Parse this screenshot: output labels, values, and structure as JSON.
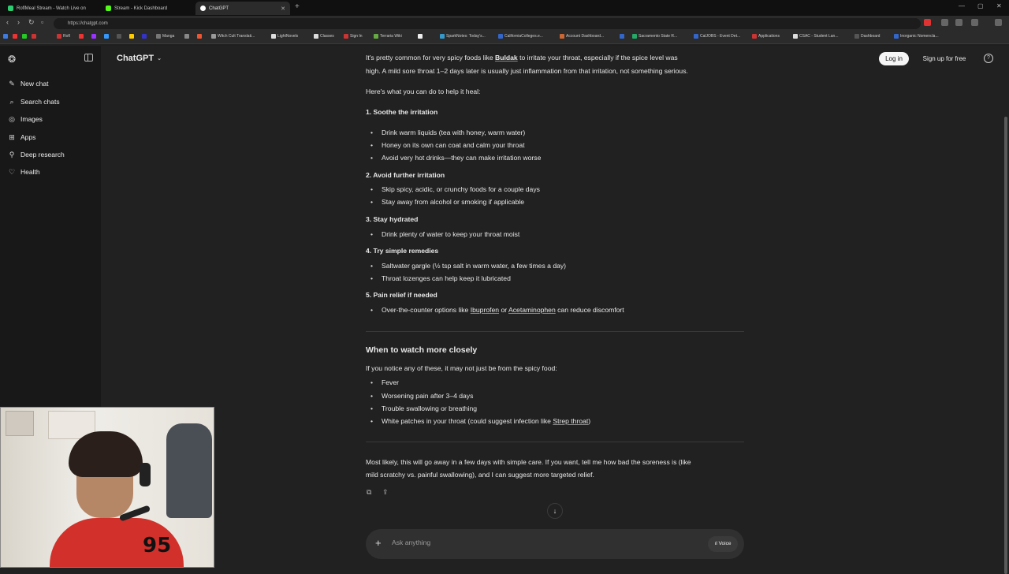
{
  "browser": {
    "tabs": [
      {
        "title": "RoflMeal Stream - Watch Live on",
        "icon_color": "#2ecc71"
      },
      {
        "title": "Stream - Kick Dashboard",
        "icon_color": "#53fc18"
      },
      {
        "title": "ChatGPT",
        "icon_color": "#ffffff"
      }
    ],
    "url": "https://chatgpt.com",
    "bookmarks": [
      "Rofl",
      "Manga",
      "Witch Cult Translati...",
      "LightNovels",
      "Classes",
      "Sign In",
      "Terraria Wiki",
      "SparkNotes: Today's...",
      "CaliforniaColleges.e...",
      "Account Dashboard...",
      "Sacramento State R...",
      "CalJOBS - Event Det...",
      "Applications",
      "CSAC - Student Lan...",
      "Dashboard",
      "Inorganic Nomencla..."
    ]
  },
  "sidebar": {
    "items": [
      {
        "label": "New chat",
        "icon": "compose-icon"
      },
      {
        "label": "Search chats",
        "icon": "search-icon"
      },
      {
        "label": "Images",
        "icon": "images-icon"
      },
      {
        "label": "Apps",
        "icon": "apps-icon"
      },
      {
        "label": "Deep research",
        "icon": "telescope-icon"
      },
      {
        "label": "Health",
        "icon": "heart-icon"
      }
    ]
  },
  "header": {
    "model": "ChatGPT",
    "login": "Log in",
    "signup": "Sign up for free",
    "help": "?"
  },
  "message": {
    "intro_a": "It's pretty common for very spicy foods like ",
    "intro_link": "Buldak",
    "intro_b": " to irritate your throat, especially if the spice level was",
    "intro_c": "high. A mild sore throat 1–2 days later is usually just inflammation from that irritation, not something serious.",
    "heal": "Here's what you can do to help it heal:",
    "s1": "1. Soothe the irritation",
    "s1_items": [
      "Drink warm liquids (tea with honey, warm water)",
      "Honey on its own can coat and calm your throat",
      "Avoid very hot drinks—they can make irritation worse"
    ],
    "s2": "2. Avoid further irritation",
    "s2_items": [
      "Skip spicy, acidic, or crunchy foods for a couple days",
      "Stay away from alcohol or smoking if applicable"
    ],
    "s3": "3. Stay hydrated",
    "s3_items": [
      "Drink plenty of water to keep your throat moist"
    ],
    "s4": "4. Try simple remedies",
    "s4_items": [
      "Saltwater gargle (½ tsp salt in warm water, a few times a day)",
      "Throat lozenges can help keep it lubricated"
    ],
    "s5": "5. Pain relief if needed",
    "s5_a": "Over-the-counter options like ",
    "s5_l1": "Ibuprofen",
    "s5_or": " or ",
    "s5_l2": "Acetaminophen",
    "s5_b": " can reduce discomfort",
    "watch_title": "When to watch more closely",
    "watch_intro": "If you notice any of these, it may not just be from the spicy food:",
    "watch_items": [
      "Fever",
      "Worsening pain after 3–4 days",
      "Trouble swallowing or breathing"
    ],
    "watch_last_a": "White patches in your throat (could suggest infection like ",
    "watch_last_link": "Strep throat",
    "watch_last_b": ")",
    "closing_a": "Most likely, this will go away in a few days with simple care. If you want, tell me how bad the soreness is (like",
    "closing_b": "mild scratchy vs. painful swallowing), and I can suggest more targeted relief."
  },
  "composer": {
    "placeholder": "Ask anything",
    "voice": "Voice"
  },
  "webcam": {
    "shirt_number": "95"
  }
}
